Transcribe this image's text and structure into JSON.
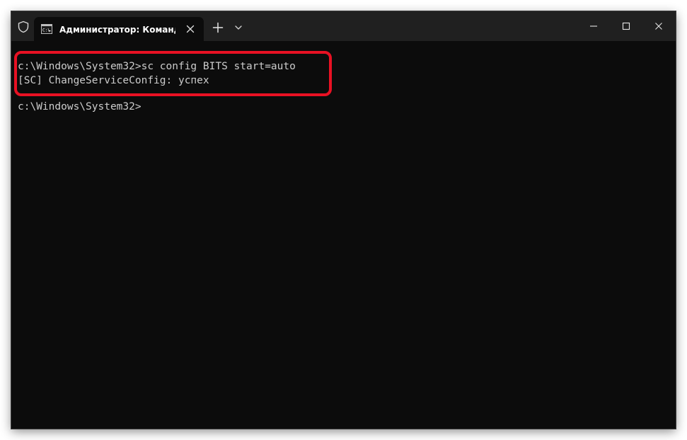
{
  "titlebar": {
    "tab_title": "Администратор: Командная строка",
    "icons": {
      "shield": "shield-icon",
      "tab": "cmd-icon",
      "close_tab": "close-icon",
      "new_tab": "plus-icon",
      "dropdown": "chevron-down-icon",
      "minimize": "minimize-icon",
      "maximize": "maximize-icon",
      "close": "close-icon"
    }
  },
  "terminal": {
    "lines": [
      "c:\\Windows\\System32>sc config BITS start=auto",
      "[SC] ChangeServiceConfig: успех",
      "c:\\Windows\\System32>"
    ]
  },
  "colors": {
    "background": "#0c0c0c",
    "titlebar": "#202020",
    "text": "#cccccc",
    "highlight": "#e81123"
  }
}
